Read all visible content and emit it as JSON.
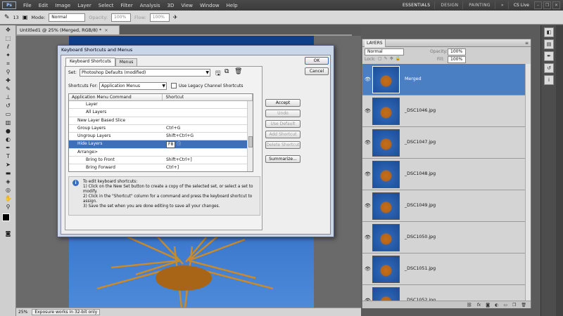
{
  "app": {
    "logo": "Ps"
  },
  "menu": [
    "File",
    "Edit",
    "Image",
    "Layer",
    "Select",
    "Filter",
    "Analysis",
    "3D",
    "View",
    "Window",
    "Help"
  ],
  "workspaces": [
    "ESSENTIALS",
    "DESIGN",
    "PAINTING"
  ],
  "more": "»",
  "cslive": "CS Live",
  "options": {
    "size": "13",
    "mode_label": "Mode:",
    "mode": "Normal",
    "opacity_label": "Opacity:",
    "opacity": "100%",
    "flow_label": "Flow:",
    "flow": "100%"
  },
  "doc_tab": {
    "title": "Untitled1 @ 25% (Merged, RGB/8) *",
    "close": "×"
  },
  "status": {
    "zoom": "25%",
    "message": "Exposure works in 32-bit only"
  },
  "dialog": {
    "title": "Keyboard Shortcuts and Menus",
    "tabs": [
      "Keyboard Shortcuts",
      "Menus"
    ],
    "set_label": "Set:",
    "set_value": "Photoshop Defaults (modified)",
    "shortcuts_for_label": "Shortcuts For:",
    "shortcuts_for_value": "Application Menus",
    "legacy_label": "Use Legacy Channel Shortcuts",
    "col_command": "Application Menu Command",
    "col_shortcut": "Shortcut",
    "rows": [
      {
        "command": "Layer",
        "shortcut": "",
        "indent": 2
      },
      {
        "command": "All Layers",
        "shortcut": "",
        "indent": 2
      },
      {
        "command": "New Layer Based Slice",
        "shortcut": "",
        "indent": 1
      },
      {
        "command": "Group Layers",
        "shortcut": "Ctrl+G",
        "indent": 1
      },
      {
        "command": "Ungroup Layers",
        "shortcut": "Shift+Ctrl+G",
        "indent": 1
      },
      {
        "command": "Hide Layers",
        "shortcut": "F8",
        "indent": 1,
        "selected": true
      },
      {
        "command": "Arrange>",
        "shortcut": "",
        "indent": 1
      },
      {
        "command": "Bring to Front",
        "shortcut": "Shift+Ctrl+]",
        "indent": 2
      },
      {
        "command": "Bring Forward",
        "shortcut": "Ctrl+]",
        "indent": 2
      }
    ],
    "buttons": {
      "ok": "OK",
      "cancel": "Cancel",
      "accept": "Accept",
      "undo": "Undo",
      "use_default": "Use Default",
      "add_shortcut": "Add Shortcut",
      "delete_shortcut": "Delete Shortcut",
      "summarize": "Summarize..."
    },
    "info_lines": [
      "To edit keyboard shortcuts:",
      "1) Click on the New Set button to create a copy of the selected set, or select a set to modify.",
      "2) Click in the \"Shortcut\" column for a command and press the keyboard shortcut to assign.",
      "3) Save the set when you are done editing to save all your changes."
    ]
  },
  "layers": {
    "tab": "LAYERS",
    "blend": "Normal",
    "opacity_label": "Opacity:",
    "opacity": "100%",
    "lock_label": "Lock:",
    "fill_label": "Fill:",
    "fill": "100%",
    "items": [
      {
        "name": "Merged",
        "selected": true
      },
      {
        "name": "_DSC1046.jpg"
      },
      {
        "name": "_DSC1047.jpg"
      },
      {
        "name": "_DSC1048.jpg"
      },
      {
        "name": "_DSC1049.jpg"
      },
      {
        "name": "_DSC1050.jpg"
      },
      {
        "name": "_DSC1051.jpg"
      },
      {
        "name": "_DSC1052.jpg"
      }
    ],
    "bottom_icons": [
      "link-icon",
      "fx-icon",
      "mask-icon",
      "adjustment-icon",
      "folder-icon",
      "new-layer-icon",
      "trash-icon"
    ]
  },
  "colors": {
    "selection": "#3e6fb8",
    "layer_selected": "#4a7fc4",
    "sky": "#2f6cc6"
  }
}
